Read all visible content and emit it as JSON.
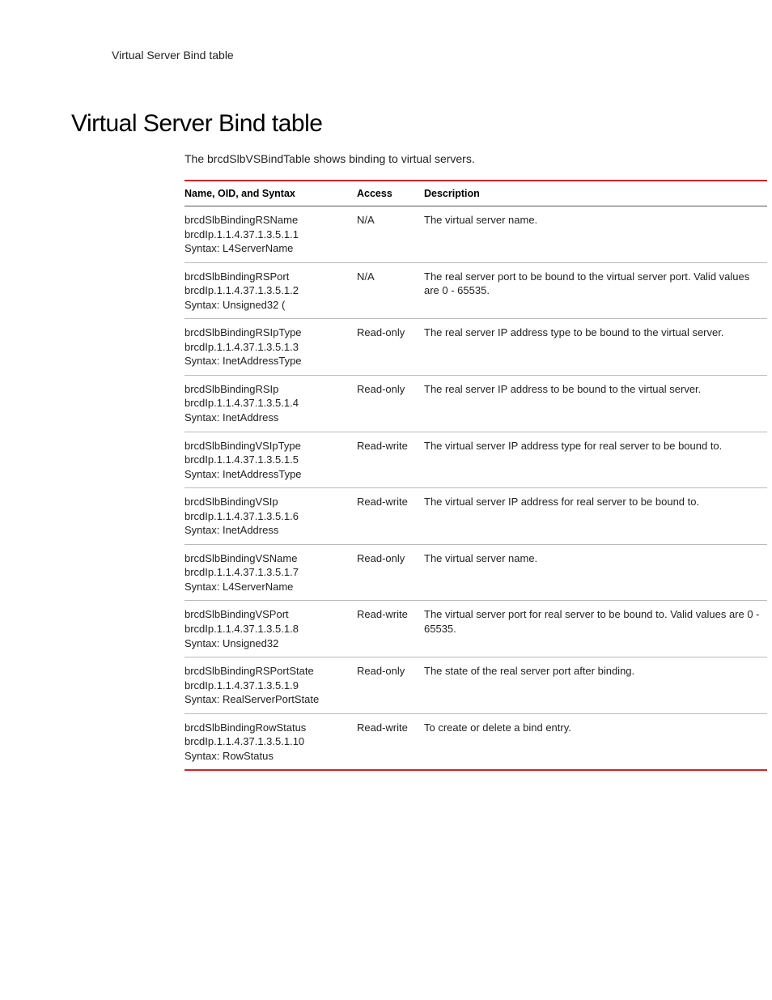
{
  "runningHeader": "Virtual Server Bind table",
  "heading": "Virtual Server Bind table",
  "intro": "The brcdSlbVSBindTable shows binding to virtual servers.",
  "columns": {
    "name": "Name, OID, and Syntax",
    "access": "Access",
    "description": "Description"
  },
  "rows": [
    {
      "name": "brcdSlbBindingRSName",
      "oid": "brcdIp.1.1.4.37.1.3.5.1.1",
      "syntax": "Syntax: L4ServerName",
      "access": "N/A",
      "description": "The virtual server name."
    },
    {
      "name": "brcdSlbBindingRSPort",
      "oid": "brcdIp.1.1.4.37.1.3.5.1.2",
      "syntax": "Syntax: Unsigned32 (",
      "access": "N/A",
      "description": "The real server port to be bound to the virtual server port. Valid values are 0 - 65535."
    },
    {
      "name": "brcdSlbBindingRSIpType",
      "oid": "brcdIp.1.1.4.37.1.3.5.1.3",
      "syntax": "Syntax:  InetAddressType",
      "access": "Read-only",
      "description": "The real server IP address type to be bound to the virtual server."
    },
    {
      "name": "brcdSlbBindingRSIp",
      "oid": "brcdIp.1.1.4.37.1.3.5.1.4",
      "syntax": "Syntax: InetAddress",
      "access": "Read-only",
      "description": "The real server IP address to be bound to the virtual server."
    },
    {
      "name": "brcdSlbBindingVSIpType",
      "oid": " brcdIp.1.1.4.37.1.3.5.1.5",
      "syntax": "Syntax: InetAddressType",
      "access": "Read-write",
      "description": "The virtual server IP address type for real server to be bound to."
    },
    {
      "name": "brcdSlbBindingVSIp",
      "oid": " brcdIp.1.1.4.37.1.3.5.1.6",
      "syntax": "Syntax: InetAddress",
      "access": "Read-write",
      "description": "The virtual server IP address for real server to be bound to."
    },
    {
      "name": "brcdSlbBindingVSName",
      "oid": "brcdIp.1.1.4.37.1.3.5.1.7",
      "syntax": "Syntax: L4ServerName",
      "access": "Read-only",
      "description": "The virtual server name."
    },
    {
      "name": "brcdSlbBindingVSPort",
      "oid": " brcdIp.1.1.4.37.1.3.5.1.8",
      "syntax": "Syntax: Unsigned32",
      "access": "Read-write",
      "description": "The virtual server port for real server to be bound to. Valid values are 0 - 65535."
    },
    {
      "name": "brcdSlbBindingRSPortState",
      "oid": " brcdIp.1.1.4.37.1.3.5.1.9",
      "syntax": "Syntax: RealServerPortState",
      "access": "Read-only",
      "description": "The state of the real server port after binding."
    },
    {
      "name": "brcdSlbBindingRowStatus",
      "oid": "brcdIp.1.1.4.37.1.3.5.1.10",
      "syntax": "Syntax: RowStatus",
      "access": "Read-write",
      "description": "To create or delete a bind entry."
    }
  ]
}
